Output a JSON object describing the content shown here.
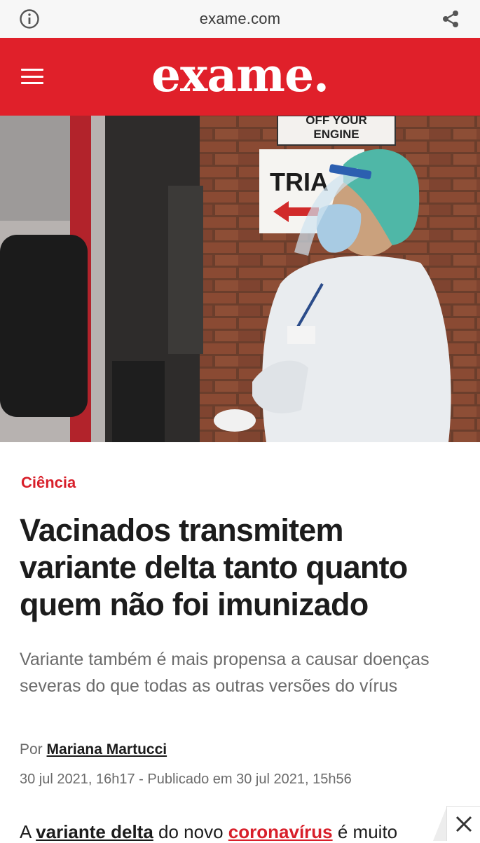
{
  "browser": {
    "url": "exame.com",
    "info_icon": "info-icon",
    "share_icon": "share-icon"
  },
  "header": {
    "logo": "exame.",
    "menu_icon": "hamburger-menu-icon",
    "brand_color": "#e0202a"
  },
  "hero": {
    "sign_top_line1": "OFF YOUR",
    "sign_top_line2": "ENGINE",
    "sign_triage": "TRIA"
  },
  "article": {
    "category": "Ciência",
    "headline": "Vacinados transmitem variante delta tanto quanto quem não foi imunizado",
    "subtitle": "Variante também é mais propensa a causar doenças severas do que todas as outras versões do vírus",
    "byline_prefix": "Por",
    "author": "Mariana Martucci",
    "dateline": "30 jul 2021, 16h17 - Publicado em 30 jul 2021, 15h56",
    "body_start": "A",
    "body_link1": "variante delta",
    "body_mid": "do novo",
    "body_link2": "coronavírus",
    "body_end": "é muito",
    "accent_color": "#d81f2a"
  },
  "ad": {
    "close_icon": "close-icon"
  }
}
